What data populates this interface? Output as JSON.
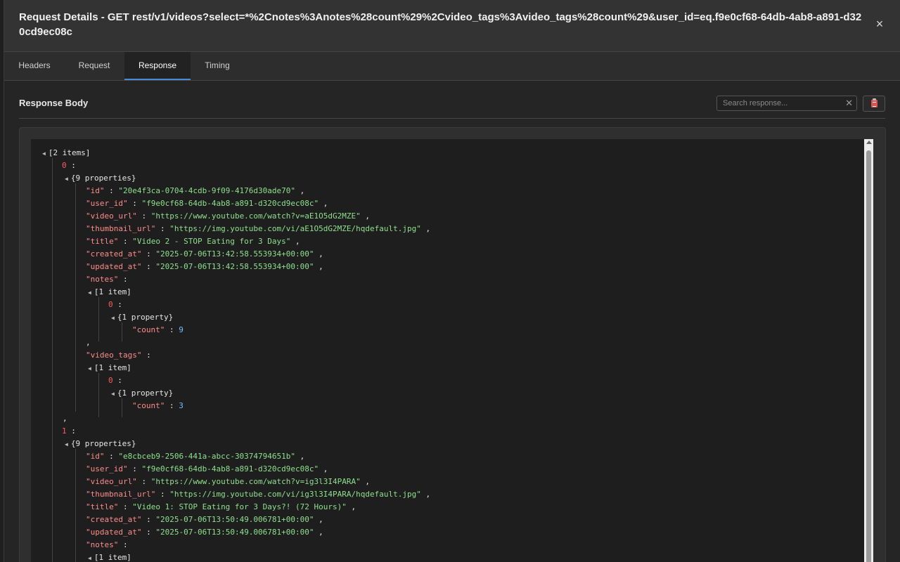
{
  "dialog": {
    "title": "Request Details - GET rest/v1/videos?select=*%2Cnotes%3Anotes%28count%29%2Cvideo_tags%3Avideo_tags%28count%29&user_id=eq.f9e0cf68-64db-4ab8-a891-d320cd9ec08c",
    "close_label": "×"
  },
  "tabs": [
    {
      "label": "Headers"
    },
    {
      "label": "Request"
    },
    {
      "label": "Response",
      "active": true
    },
    {
      "label": "Timing"
    }
  ],
  "response": {
    "section_title": "Response Body",
    "search_placeholder": "Search response...",
    "clear_label": "✕"
  },
  "json": {
    "root_summary": "[2 items]",
    "items": [
      {
        "index": "0",
        "summary": "{9 properties}",
        "fields": [
          {
            "key": "\"id\"",
            "value": "\"20e4f3ca-0704-4cdb-9f09-4176d30ade70\""
          },
          {
            "key": "\"user_id\"",
            "value": "\"f9e0cf68-64db-4ab8-a891-d320cd9ec08c\""
          },
          {
            "key": "\"video_url\"",
            "value": "\"https://www.youtube.com/watch?v=aE1O5dG2MZE\""
          },
          {
            "key": "\"thumbnail_url\"",
            "value": "\"https://img.youtube.com/vi/aE1O5dG2MZE/hqdefault.jpg\""
          },
          {
            "key": "\"title\"",
            "value": "\"Video 2 - STOP Eating for 3 Days\""
          },
          {
            "key": "\"created_at\"",
            "value": "\"2025-07-06T13:42:58.553934+00:00\""
          },
          {
            "key": "\"updated_at\"",
            "value": "\"2025-07-06T13:42:58.553934+00:00\""
          }
        ],
        "notes": {
          "key": "\"notes\"",
          "summary": "[1 item]",
          "index": "0",
          "obj_summary": "{1 property}",
          "count_key": "\"count\"",
          "count": "9"
        },
        "video_tags": {
          "key": "\"video_tags\"",
          "summary": "[1 item]",
          "index": "0",
          "obj_summary": "{1 property}",
          "count_key": "\"count\"",
          "count": "3"
        }
      },
      {
        "index": "1",
        "summary": "{9 properties}",
        "fields": [
          {
            "key": "\"id\"",
            "value": "\"e8cbceb9-2506-441a-abcc-30374794651b\""
          },
          {
            "key": "\"user_id\"",
            "value": "\"f9e0cf68-64db-4ab8-a891-d320cd9ec08c\""
          },
          {
            "key": "\"video_url\"",
            "value": "\"https://www.youtube.com/watch?v=ig3l3I4PARA\""
          },
          {
            "key": "\"thumbnail_url\"",
            "value": "\"https://img.youtube.com/vi/ig3l3I4PARA/hqdefault.jpg\""
          },
          {
            "key": "\"title\"",
            "value": "\"Video 1: STOP Eating for 3 Days?! (72 Hours)\""
          },
          {
            "key": "\"created_at\"",
            "value": "\"2025-07-06T13:50:49.006781+00:00\""
          },
          {
            "key": "\"updated_at\"",
            "value": "\"2025-07-06T13:50:49.006781+00:00\""
          }
        ],
        "notes": {
          "key": "\"notes\"",
          "summary": "[1 item]"
        }
      }
    ]
  },
  "colors": {
    "accent": "#4a8bd8",
    "key": "#ff8b8b",
    "index": "#ff5c5c",
    "string": "#8ee08e",
    "number": "#6ec0ff"
  }
}
